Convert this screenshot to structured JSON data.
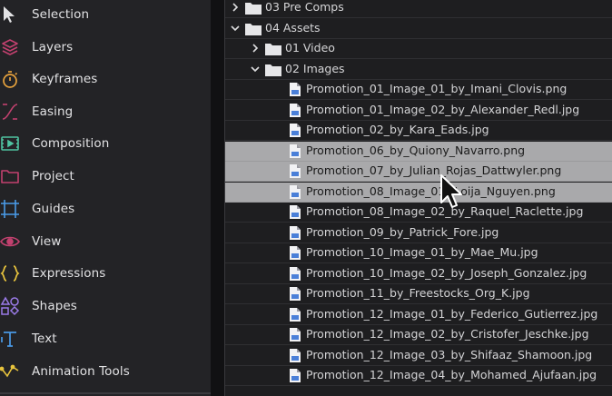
{
  "sidebar": {
    "items": [
      {
        "label": "Selection",
        "icon": "selection-icon"
      },
      {
        "label": "Layers",
        "icon": "layers-icon"
      },
      {
        "label": "Keyframes",
        "icon": "stopwatch-icon"
      },
      {
        "label": "Easing",
        "icon": "easing-curve-icon"
      },
      {
        "label": "Composition",
        "icon": "composition-icon"
      },
      {
        "label": "Project",
        "icon": "folder-icon"
      },
      {
        "label": "Guides",
        "icon": "guides-icon"
      },
      {
        "label": "View",
        "icon": "eye-icon"
      },
      {
        "label": "Expressions",
        "icon": "braces-icon"
      },
      {
        "label": "Shapes",
        "icon": "shapes-icon"
      },
      {
        "label": "Text",
        "icon": "text-icon"
      },
      {
        "label": "Animation Tools",
        "icon": "animation-tools-icon"
      }
    ]
  },
  "colors": {
    "accent": "#c2416f",
    "sidebar_bg": "#232326",
    "tree_bg": "#1e1e20",
    "selected_row": "#a9a9ab"
  },
  "tree": {
    "rows": [
      {
        "label": "03 Pre Comps",
        "type": "folder",
        "expanded": false
      },
      {
        "label": "04 Assets",
        "type": "folder",
        "expanded": true
      },
      {
        "label": "01 Video",
        "type": "folder",
        "expanded": false
      },
      {
        "label": "02 Images",
        "type": "folder",
        "expanded": true
      },
      {
        "label": "Promotion_01_Image_01_by_Imani_Clovis.png",
        "type": "file",
        "selected": false
      },
      {
        "label": "Promotion_01_Image_02_by_Alexander_Redl.jpg",
        "type": "file",
        "selected": false
      },
      {
        "label": "Promotion_02_by_Kara_Eads.jpg",
        "type": "file",
        "selected": false
      },
      {
        "label": "Promotion_06_by_Quiony_Navarro.png",
        "type": "file",
        "selected": true
      },
      {
        "label": "Promotion_07_by_Julian_Rojas_Dattwyler.png",
        "type": "file",
        "selected": true
      },
      {
        "label": "Promotion_08_Image_01_ Loija_Nguyen.png",
        "type": "file",
        "selected": true
      },
      {
        "label": "Promotion_08_Image_02_by_Raquel_Raclette.jpg",
        "type": "file",
        "selected": false
      },
      {
        "label": "Promotion_09_by_Patrick_Fore.jpg",
        "type": "file",
        "selected": false
      },
      {
        "label": "Promotion_10_Image_01_by_Mae_Mu.jpg",
        "type": "file",
        "selected": false
      },
      {
        "label": "Promotion_10_Image_02_by_Joseph_Gonzalez.jpg",
        "type": "file",
        "selected": false
      },
      {
        "label": "Promotion_11_by_Freestocks_Org_K.jpg",
        "type": "file",
        "selected": false
      },
      {
        "label": "Promotion_12_Image_01_by_Federico_Gutierrez.jpg",
        "type": "file",
        "selected": false
      },
      {
        "label": "Promotion_12_Image_02_by_Cristofer_Jeschke.jpg",
        "type": "file",
        "selected": false
      },
      {
        "label": "Promotion_12_Image_03_by_Shifaaz_Shamoon.jpg",
        "type": "file",
        "selected": false
      },
      {
        "label": "Promotion_12_Image_04_by_Mohamed_Ajufaan.jpg",
        "type": "file",
        "selected": false
      }
    ]
  }
}
